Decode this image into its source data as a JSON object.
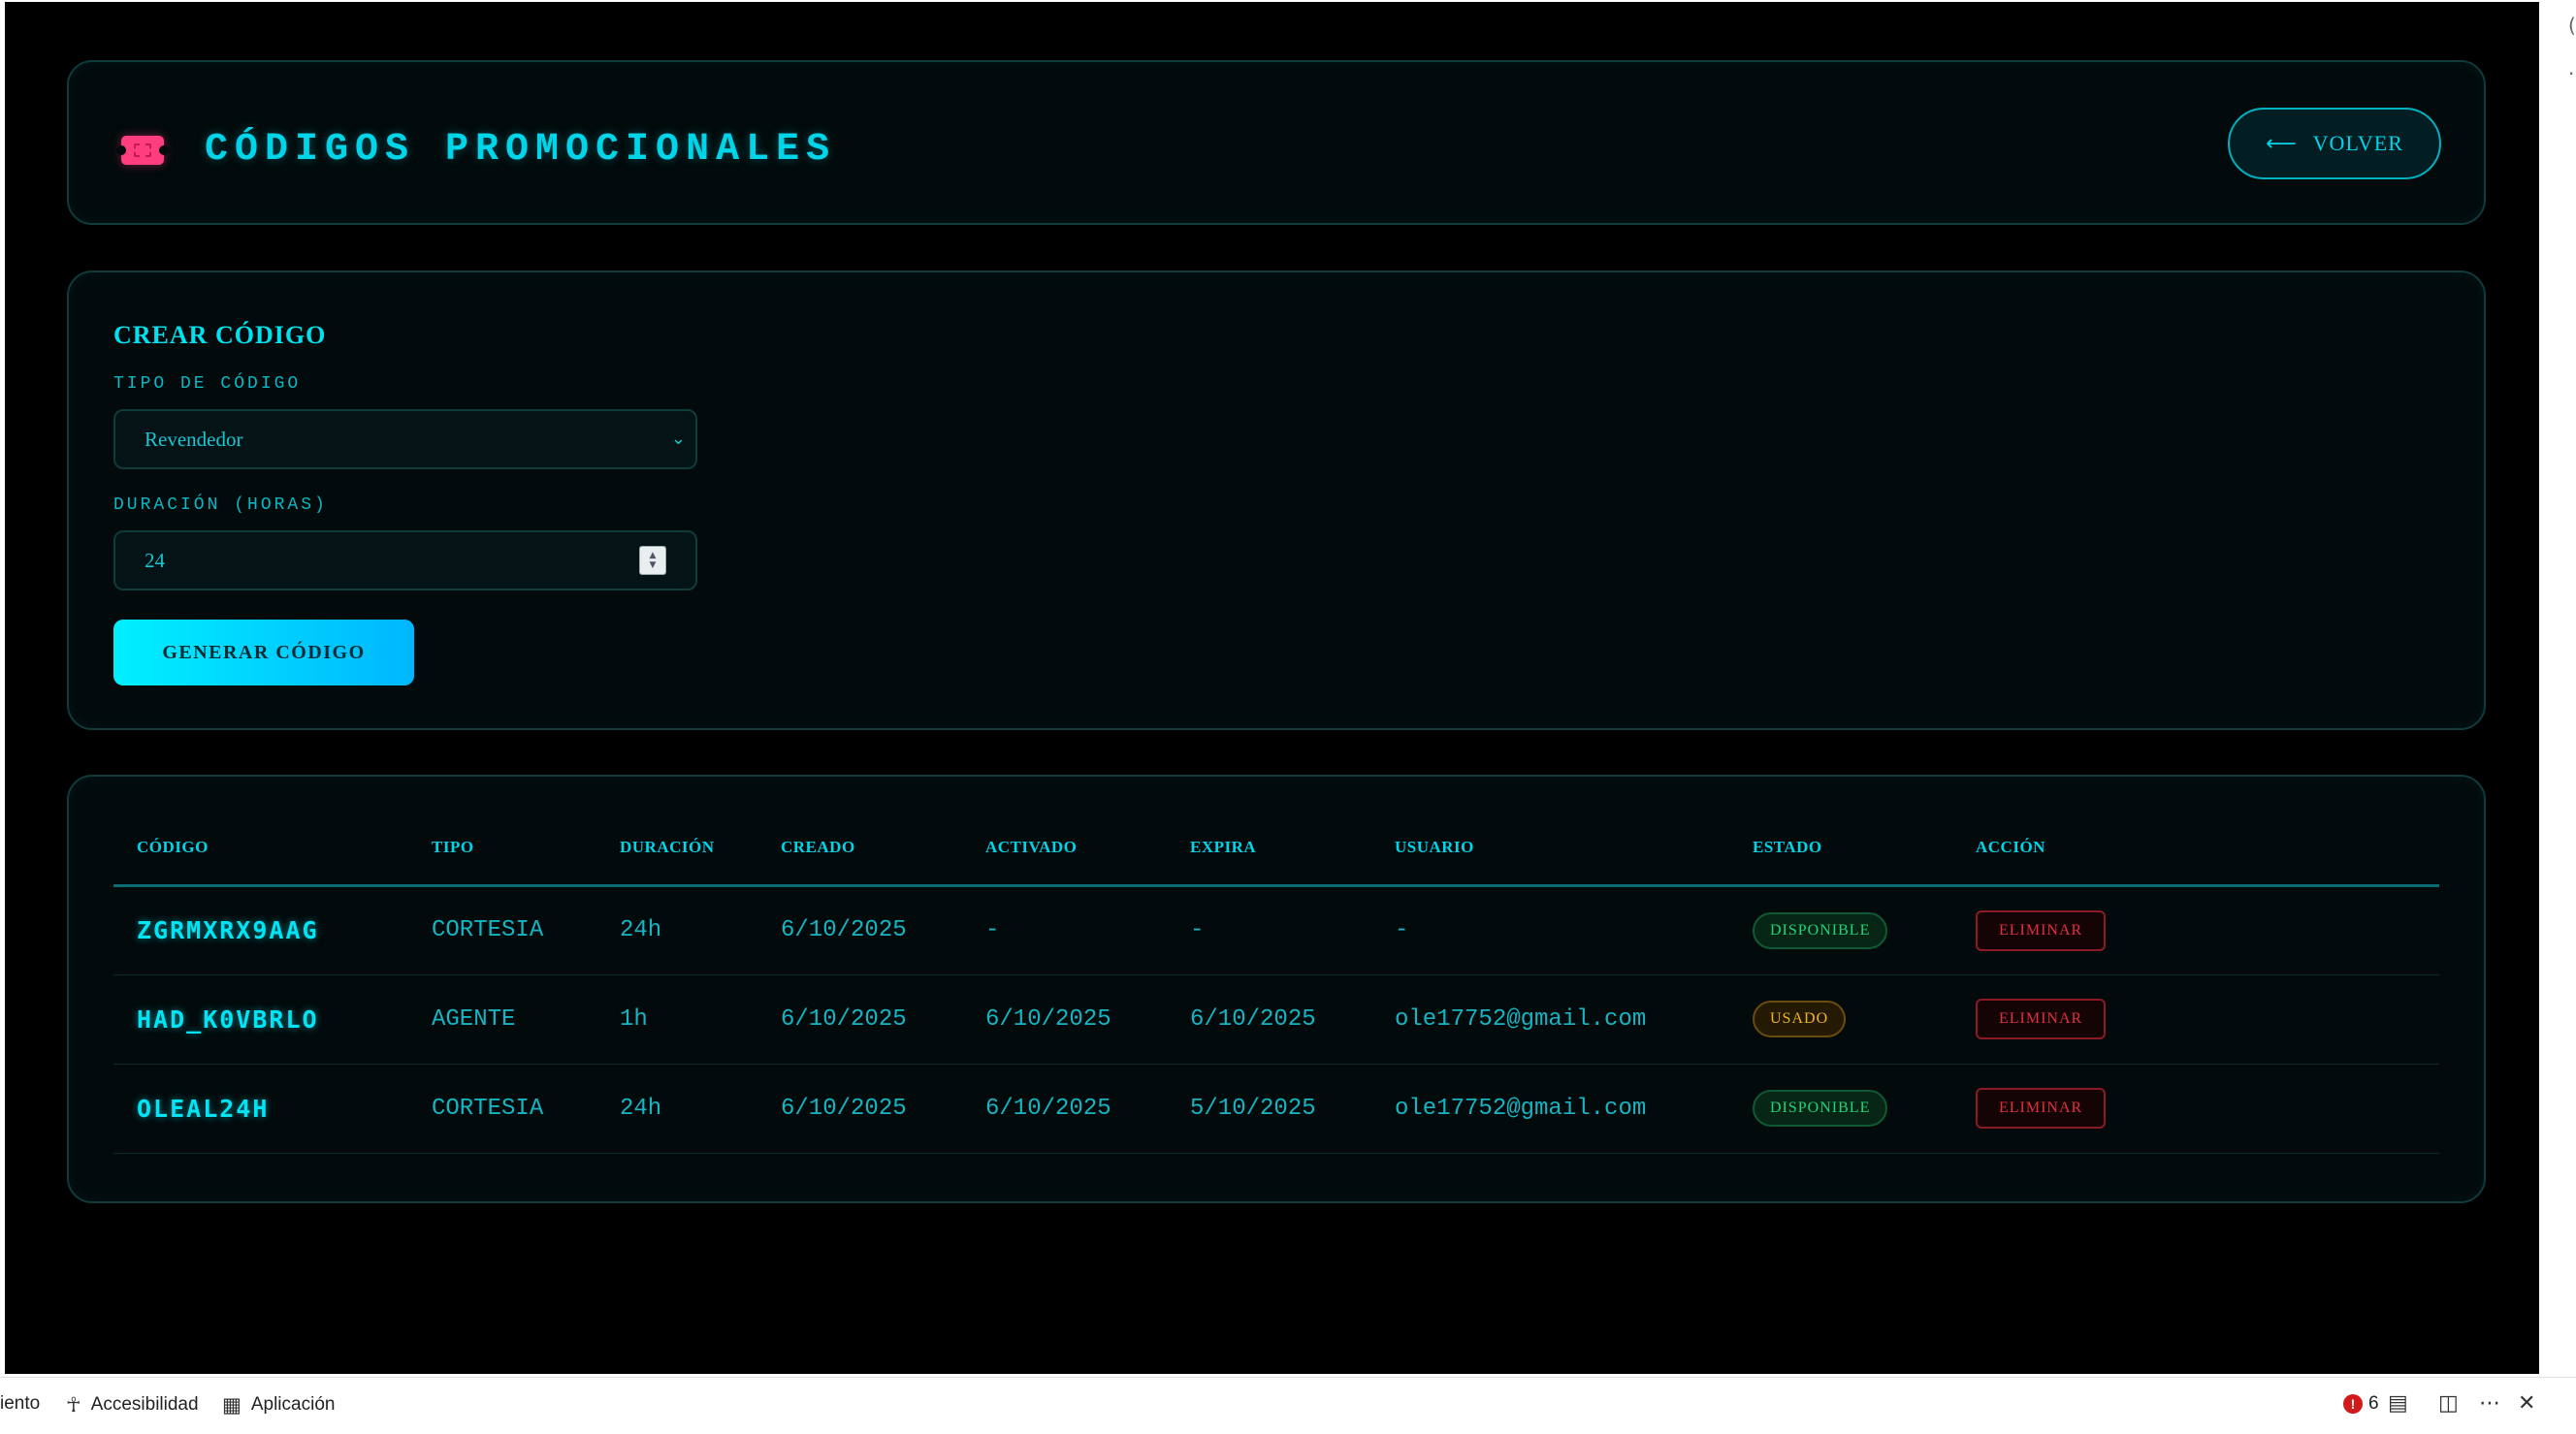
{
  "header": {
    "title": "CÓDIGOS PROMOCIONALES",
    "back_arrow": "⟵",
    "back_label": "VOLVER"
  },
  "create": {
    "title": "CREAR CÓDIGO",
    "type_label": "TIPO DE CÓDIGO",
    "type_value": "Revendedor",
    "duration_label": "DURACIÓN (HORAS)",
    "duration_value": "24",
    "generate_label": "GENERAR CÓDIGO"
  },
  "table": {
    "columns": [
      "CÓDIGO",
      "TIPO",
      "DURACIÓN",
      "CREADO",
      "ACTIVADO",
      "EXPIRA",
      "USUARIO",
      "ESTADO",
      "ACCIÓN"
    ],
    "rows": [
      {
        "code": "ZGRMXRX9AAG",
        "type": "CORTESIA",
        "duration": "24h",
        "created": "6/10/2025",
        "activated": "-",
        "expires": "-",
        "user": "-",
        "status": "DISPONIBLE",
        "status_kind": "available",
        "action": "ELIMINAR"
      },
      {
        "code": "HAD_K0VBRLO",
        "type": "AGENTE",
        "duration": "1h",
        "created": "6/10/2025",
        "activated": "6/10/2025",
        "expires": "6/10/2025",
        "user": "ole17752@gmail.com",
        "status": "USADO",
        "status_kind": "used",
        "action": "ELIMINAR"
      },
      {
        "code": "OLEAL24H",
        "type": "CORTESIA",
        "duration": "24h",
        "created": "6/10/2025",
        "activated": "6/10/2025",
        "expires": "5/10/2025",
        "user": "ole17752@gmail.com",
        "status": "DISPONIBLE",
        "status_kind": "available",
        "action": "ELIMINAR"
      }
    ]
  },
  "bottom_bar": {
    "partial_item": "iento",
    "accessibility": "Accesibilidad",
    "app": "Aplicación",
    "error_count": "6"
  },
  "colors": {
    "accent": "#00d4e8",
    "background": "#000000",
    "panel_border": "#0f3b3b",
    "ticket_pink": "#ff3d7f",
    "available_green": "#1fd57a",
    "used_amber": "#f0b428",
    "delete_red": "#e2303e"
  },
  "icons": [
    "ticket-icon",
    "arrow-left-icon",
    "chevron-down-icon",
    "spinner-icon",
    "accessibility-icon",
    "apps-grid-icon",
    "error-icon",
    "layout-icon",
    "dock-icon",
    "more-icon",
    "close-icon"
  ]
}
